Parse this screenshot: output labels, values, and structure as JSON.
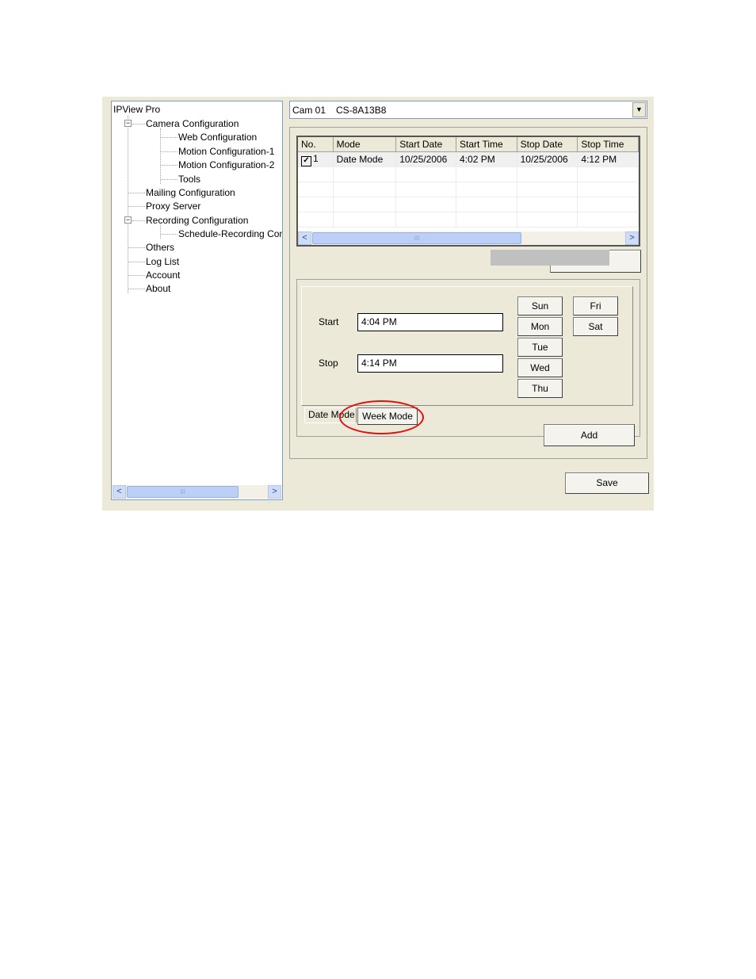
{
  "tree": {
    "root": "IPView Pro",
    "items": [
      {
        "label": "Camera Configuration",
        "level": 1,
        "expander": "−"
      },
      {
        "label": "Web Configuration",
        "level": 2
      },
      {
        "label": "Motion Configuration-1",
        "level": 2
      },
      {
        "label": "Motion Configuration-2",
        "level": 2
      },
      {
        "label": "Tools",
        "level": 2
      },
      {
        "label": "Mailing Configuration",
        "level": 1
      },
      {
        "label": "Proxy Server",
        "level": 1
      },
      {
        "label": "Recording Configuration",
        "level": 1,
        "expander": "−"
      },
      {
        "label": "Schedule-Recording Con",
        "level": 2
      },
      {
        "label": "Others",
        "level": 1
      },
      {
        "label": "Log List",
        "level": 1
      },
      {
        "label": "Account",
        "level": 1
      },
      {
        "label": "About",
        "level": 1
      }
    ]
  },
  "camera_select": {
    "cam": "Cam 01",
    "name": "CS-8A13B8"
  },
  "schedule_table": {
    "columns": [
      "No.",
      "Mode",
      "Start Date",
      "Start Time",
      "Stop Date",
      "Stop Time"
    ],
    "rows": [
      {
        "no": "1",
        "checked": true,
        "mode": "Date Mode",
        "start_date": "10/25/2006",
        "start_time": "4:02 PM",
        "stop_date": "10/25/2006",
        "stop_time": "4:12 PM"
      }
    ]
  },
  "form": {
    "start_label": "Start",
    "start_value": "4:04 PM",
    "stop_label": "Stop",
    "stop_value": "4:14 PM",
    "days": [
      "Sun",
      "Mon",
      "Tue",
      "Wed",
      "Thu",
      "Fri",
      "Sat"
    ]
  },
  "tabs": {
    "date_mode": "Date Mode",
    "week_mode": "Week Mode"
  },
  "buttons": {
    "add": "Add",
    "save": "Save"
  },
  "scroll_glyphs": {
    "left": "<",
    "right": ">",
    "grip": "III",
    "dropdown": "▼",
    "check": "✓"
  },
  "colors": {
    "window_bg": "#ece9d8",
    "highlight_ring": "#e01010",
    "field_border": "#7f9db9"
  }
}
